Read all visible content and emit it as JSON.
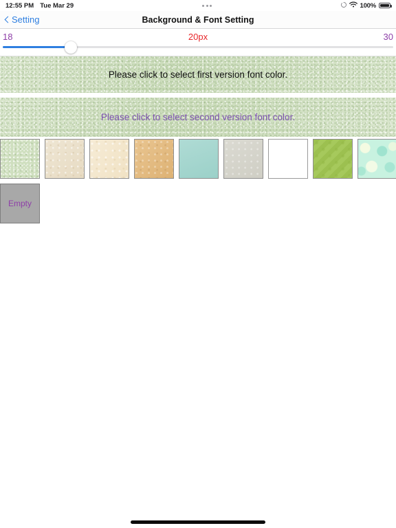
{
  "status_bar": {
    "time": "12:55 PM",
    "date": "Tue Mar 29",
    "battery_percent": "100%",
    "icons": [
      "location-arrow-icon",
      "wifi-icon",
      "battery-icon"
    ],
    "multitask_dots": "•••"
  },
  "nav_bar": {
    "back_label": "Setting",
    "title": "Background & Font Setting"
  },
  "font_size_slider": {
    "min_label": "18",
    "max_label": "30",
    "current_label": "20px",
    "min_value": 18,
    "max_value": 30,
    "current_value": 20,
    "fill_percent": 17.5,
    "min_color": "#8e3fa8",
    "max_color": "#8e3fa8",
    "current_color": "#e8262a",
    "fill_color": "#2f7fe0",
    "track_color": "#e2e2e4"
  },
  "preview_panels": [
    {
      "name": "first-version",
      "text": "Please click to select first version font color.",
      "font_color": "#111111",
      "background": "#cfdfbf"
    },
    {
      "name": "second-version",
      "text": "Please click to select second version font color.",
      "font_color": "#7b4fb0",
      "background": "#cfdfbf"
    }
  ],
  "swatches": [
    {
      "name": "green-paper",
      "label": "",
      "color": "#cfdfbf"
    },
    {
      "name": "beige-paper",
      "label": "",
      "color": "#eadfc8"
    },
    {
      "name": "cream-paper",
      "label": "",
      "color": "#f3e5c8"
    },
    {
      "name": "tan-paper",
      "label": "",
      "color": "#e4b878"
    },
    {
      "name": "aqua-solid",
      "label": "",
      "color": "#9fd4cc"
    },
    {
      "name": "warm-gray-solid",
      "label": "",
      "color": "#d3d2c8"
    },
    {
      "name": "white-solid",
      "label": "",
      "color": "#ffffff"
    },
    {
      "name": "green-triangles",
      "label": "",
      "color": "#a6c95c"
    },
    {
      "name": "mint-mottled",
      "label": "",
      "color": "#c8f2e0"
    }
  ],
  "empty_swatch": {
    "label": "Empty",
    "background": "#a8a8a8",
    "text_color": "#8e3fa8"
  }
}
